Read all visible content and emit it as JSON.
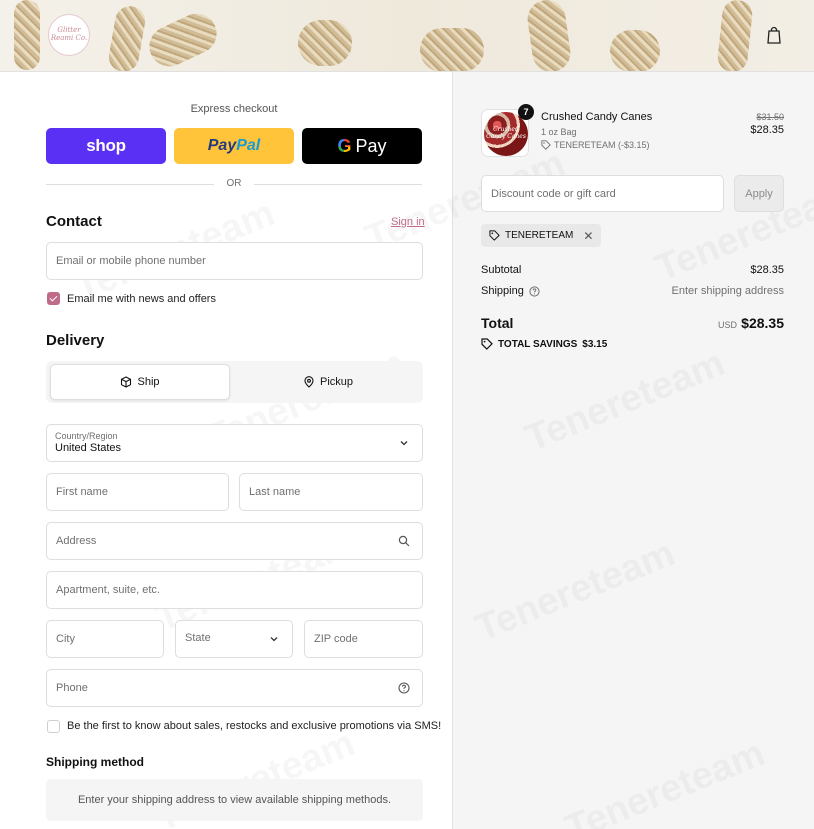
{
  "header": {
    "logo_text": "Glitter Reami Co.",
    "bag_icon": "shopping-bag-icon"
  },
  "express": {
    "label": "Express checkout",
    "shop_label": "shop",
    "paypal_label_1": "Pay",
    "paypal_label_2": "Pal",
    "gpay_g": "G",
    "gpay_label": "Pay",
    "or_label": "OR"
  },
  "contact": {
    "title": "Contact",
    "signin_label": "Sign in",
    "email_placeholder": "Email or mobile phone number",
    "newsletter_label": "Email me with news and offers",
    "newsletter_checked": true
  },
  "delivery": {
    "title": "Delivery",
    "ship_label": "Ship",
    "pickup_label": "Pickup",
    "country_label": "Country/Region",
    "country_value": "United States",
    "first_name_placeholder": "First name",
    "last_name_placeholder": "Last name",
    "address_placeholder": "Address",
    "apartment_placeholder": "Apartment, suite, etc.",
    "city_placeholder": "City",
    "state_placeholder": "State",
    "zip_placeholder": "ZIP code",
    "phone_placeholder": "Phone",
    "sms_label": "Be the first to know about sales, restocks and exclusive promotions via SMS!",
    "sms_checked": false
  },
  "shipping_method": {
    "title": "Shipping method",
    "note": "Enter your shipping address to view available shipping methods."
  },
  "summary": {
    "product": {
      "name": "Crushed Candy Canes",
      "variant": "1 oz Bag",
      "discount": "TENERETEAM (-$3.15)",
      "quantity": "7",
      "thumb_text": "Crushed Candy Canes",
      "price_old": "$31.50",
      "price_new": "$28.35"
    },
    "discount_placeholder": "Discount code or gift card",
    "apply_label": "Apply",
    "applied_code": "TENERETEAM",
    "subtotal_label": "Subtotal",
    "subtotal_value": "$28.35",
    "shipping_label": "Shipping",
    "shipping_value": "Enter shipping address",
    "total_label": "Total",
    "total_currency": "USD",
    "total_value": "$28.35",
    "savings_label": "TOTAL SAVINGS",
    "savings_value": "$3.15"
  },
  "watermark": "Tenereteam",
  "colors": {
    "accent": "#c06b8a",
    "shop_purple": "#5a31f4",
    "paypal_yellow": "#ffc439"
  }
}
